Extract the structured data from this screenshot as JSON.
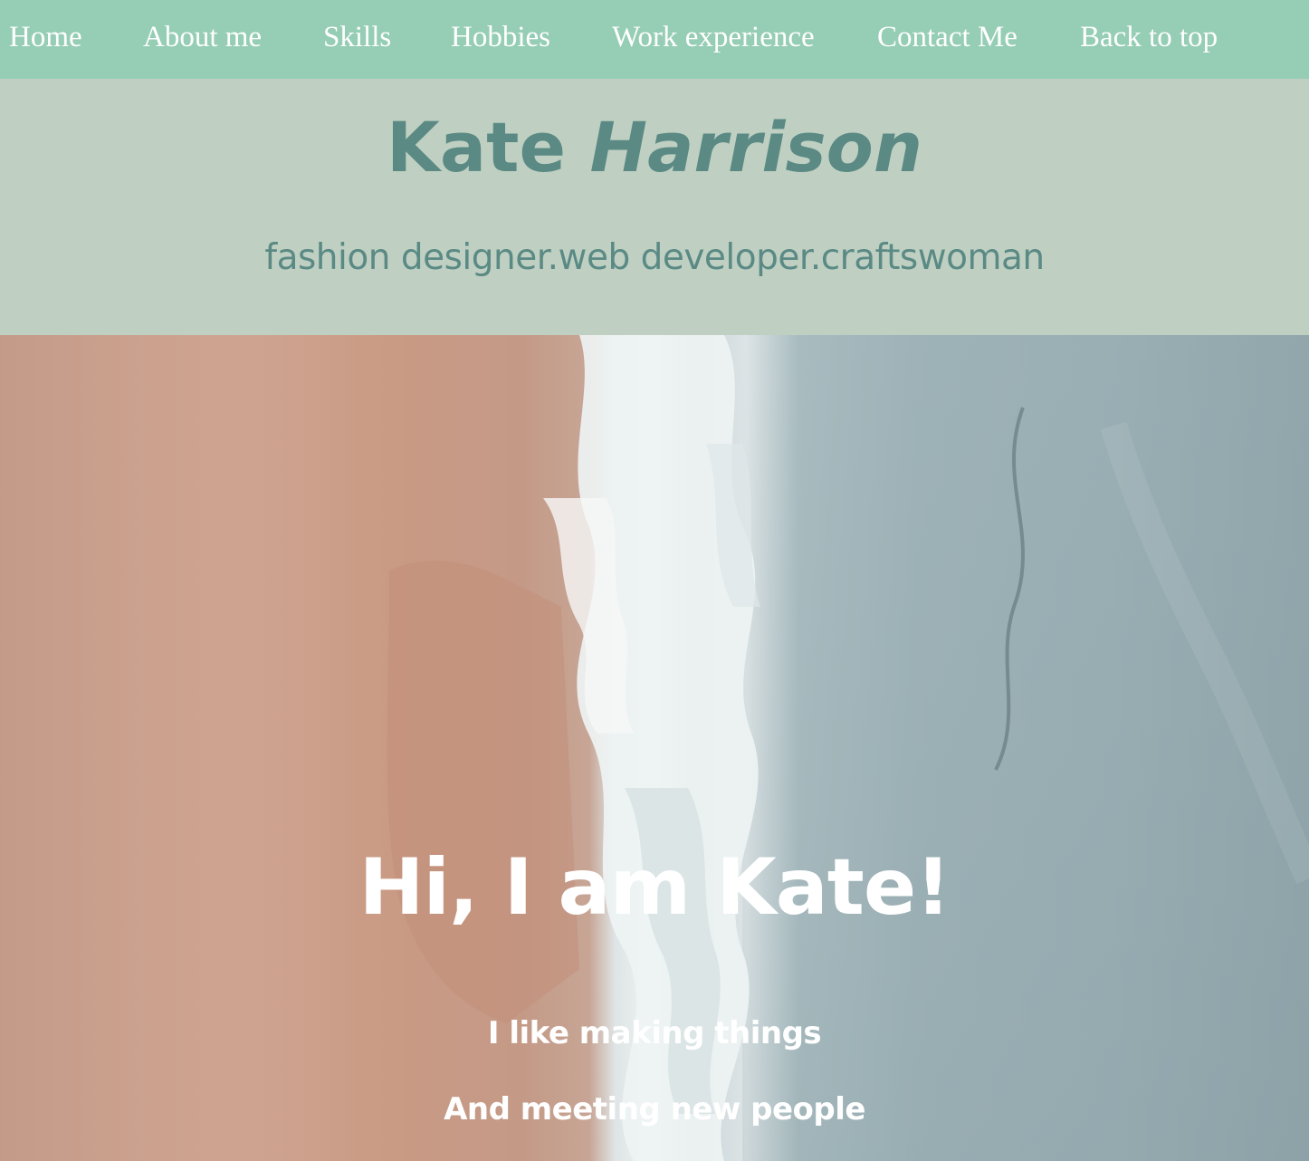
{
  "nav": {
    "items": [
      {
        "label": "Home"
      },
      {
        "label": "About me"
      },
      {
        "label": "Skills"
      },
      {
        "label": "Hobbies"
      },
      {
        "label": "Work experience"
      },
      {
        "label": "Contact Me"
      },
      {
        "label": "Back to top"
      }
    ]
  },
  "header": {
    "first_name": "Kate",
    "last_name": "Harrison",
    "tagline": "fashion designer.web developer.craftswoman"
  },
  "hero": {
    "heading": "Hi, I am Kate!",
    "line1": "I like making things",
    "line2": "And meeting new people"
  },
  "colors": {
    "nav_bg": "#96cdb5",
    "header_bg": "#bfd0c2",
    "header_text": "#5b8a85",
    "hero_text": "#ffffff"
  }
}
